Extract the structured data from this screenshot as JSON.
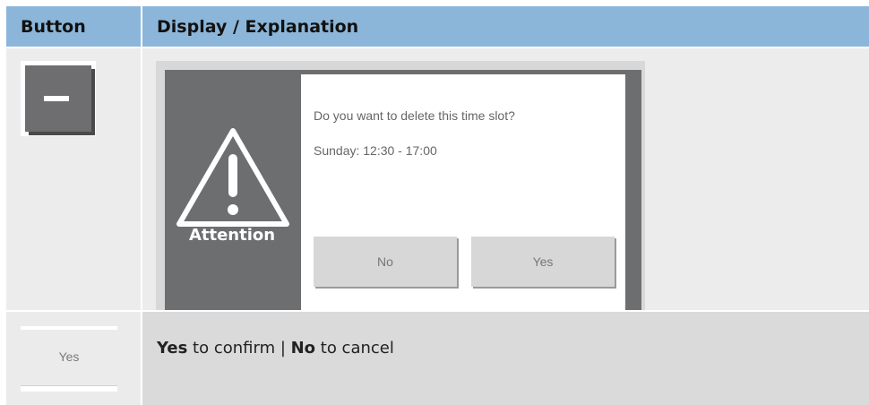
{
  "header": {
    "col_button": "Button",
    "col_display": "Display / Explanation"
  },
  "row1": {
    "button_icon": "minus-icon",
    "dialog": {
      "question": "Do you want to delete this time slot?",
      "time_slot": "Sunday: 12:30 - 17:00",
      "warning_label": "Attention",
      "warning_icon": "warning-triangle-icon",
      "no_label": "No",
      "yes_label": "Yes"
    }
  },
  "row2": {
    "button_label": "Yes",
    "explanation": {
      "yes_word": "Yes",
      "yes_text": " to confirm | ",
      "no_word": "No",
      "no_text": " to cancel"
    }
  },
  "colors": {
    "header_bg": "#8cb6d9",
    "dialog_frame": "#6d6e70",
    "cell_bg": "#ececec"
  }
}
